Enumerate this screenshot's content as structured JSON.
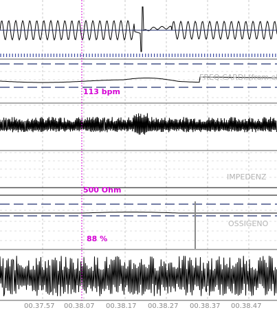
{
  "channels": [
    {
      "name": "FREQ.CARDI.(from ele",
      "value": "113 bpm"
    },
    {
      "name": "IMPEDENZ",
      "value": "500 Ohm"
    },
    {
      "name": "OSSIGENO",
      "value": "88 %"
    }
  ],
  "time_axis": {
    "ticks": [
      "00.37.57",
      "00.38.07",
      "00.38.17",
      "00.38.27",
      "00.38.37",
      "00.38.47"
    ]
  },
  "colors": {
    "trace": "#000000",
    "grid": "#c8c8c8",
    "separator": "#5a5a5a",
    "baseline": "#1f2d6e",
    "cursor": "#d400d4",
    "value_text": "#d400d4",
    "channel_label": "#b4b4b4",
    "tick_text": "#8a8a8a"
  }
}
